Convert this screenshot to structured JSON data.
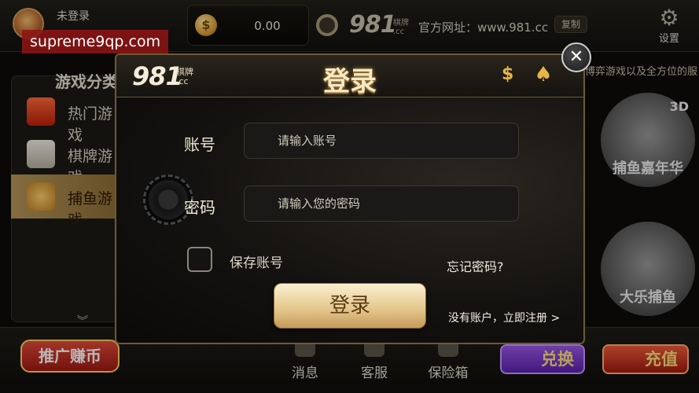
{
  "watermark": "supreme9qp.com",
  "header": {
    "username": "未登录",
    "balance": "0.00",
    "brand": "981",
    "brand_sub": "棋牌\n.cc",
    "site_url": "官方网址：www.981.cc",
    "copy_label": "复制",
    "settings_label": "设置"
  },
  "sidebar": {
    "title": "游戏分类",
    "items": [
      {
        "label": "热门游戏",
        "icon": "hot-icon"
      },
      {
        "label": "棋牌游戏",
        "icon": "cards-icon"
      },
      {
        "label": "捕鱼游戏",
        "icon": "fish-icon"
      }
    ]
  },
  "marquee": "博弈游戏以及全方位的服",
  "games": [
    {
      "caption": "捕鱼嘉年华",
      "badge": "3D"
    },
    {
      "caption": "大乐捕鱼",
      "badge": ""
    }
  ],
  "bottom": {
    "promo": "推广赚币",
    "nav": [
      {
        "label": "消息"
      },
      {
        "label": "客服"
      },
      {
        "label": "保险箱"
      }
    ],
    "exchange": "兑换",
    "recharge": "充值"
  },
  "dialog": {
    "logo": "981",
    "logo_sub": "棋牌\n.cc",
    "title": "登录",
    "account_label": "账号",
    "account_placeholder": "请输入账号",
    "password_label": "密码",
    "password_placeholder": "请输入您的密码",
    "save_label": "保存账号",
    "forgot_label": "忘记密码?",
    "login_button": "登录",
    "register_label": "没有账户，立即注册 >",
    "close_glyph": "✕"
  }
}
